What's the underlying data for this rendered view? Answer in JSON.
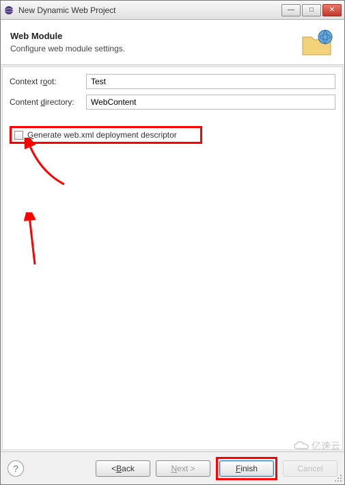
{
  "titlebar": {
    "title": "New Dynamic Web Project"
  },
  "header": {
    "title": "Web Module",
    "subtitle": "Configure web module settings."
  },
  "form": {
    "context_root_label": "Context root:",
    "context_root_value": "Test",
    "content_dir_label": "Content directory:",
    "content_dir_value": "WebContent",
    "generate_webxml_label": "Generate web.xml deployment descriptor"
  },
  "buttons": {
    "back": "< Back",
    "next": "Next >",
    "finish": "Finish",
    "cancel": "Cancel"
  },
  "watermark": "亿速云"
}
